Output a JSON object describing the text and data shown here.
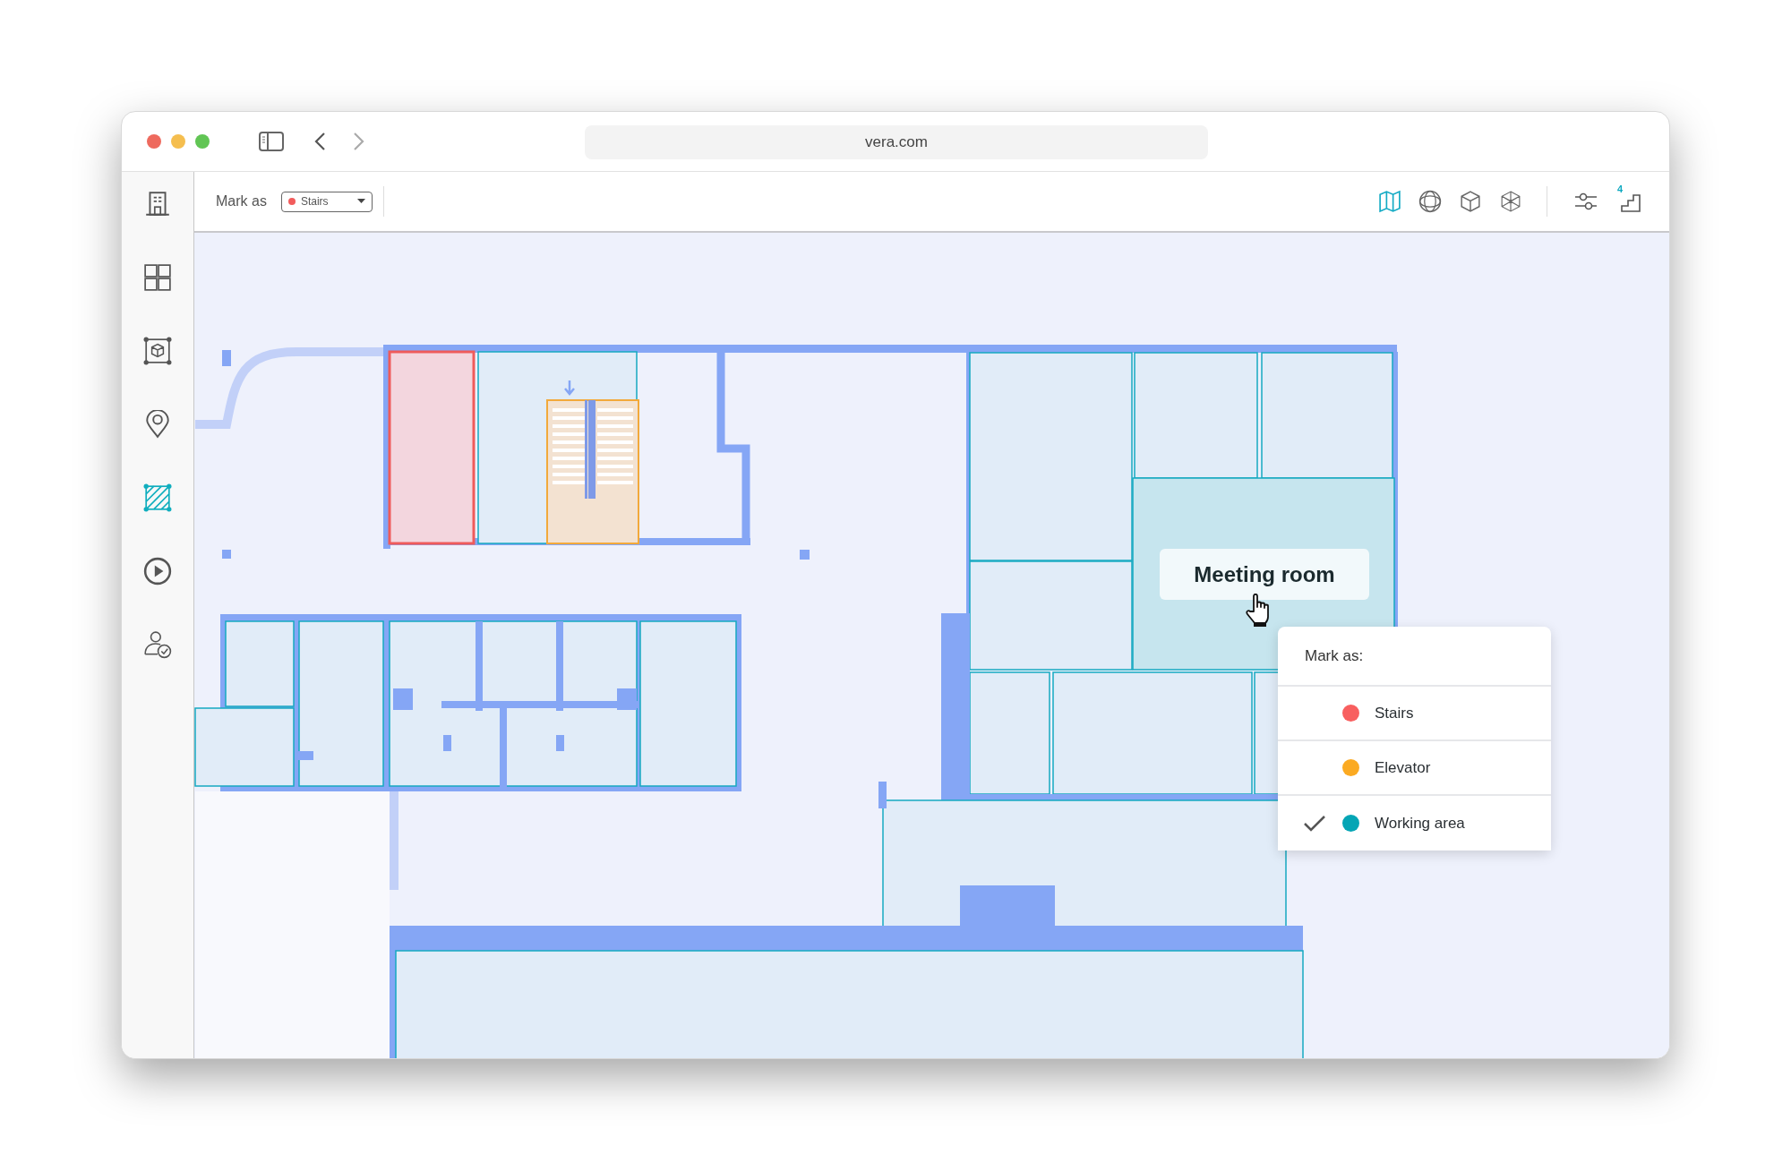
{
  "browser": {
    "url": "vera.com"
  },
  "sidebar": {
    "items": [
      {
        "kind": "building",
        "selected": false
      },
      {
        "kind": "grid",
        "selected": false
      },
      {
        "kind": "model",
        "selected": false
      },
      {
        "kind": "pin",
        "selected": false
      },
      {
        "kind": "area",
        "selected": true
      },
      {
        "kind": "play",
        "selected": false
      },
      {
        "kind": "user",
        "selected": false
      }
    ]
  },
  "toolbar": {
    "label": "Mark as",
    "dropdown": {
      "value": "Stairs",
      "color": "#f25c5c"
    },
    "view_modes": [
      {
        "kind": "map",
        "selected": true
      },
      {
        "kind": "globe",
        "selected": false
      },
      {
        "kind": "cube",
        "selected": false
      },
      {
        "kind": "wireframe",
        "selected": false
      }
    ],
    "floor_badge": "4"
  },
  "map": {
    "tooltip": "Meeting room"
  },
  "menu": {
    "title": "Mark as:",
    "options": [
      {
        "label": "Stairs",
        "color": "#f85f5f",
        "selected": false
      },
      {
        "label": "Elevator",
        "color": "#fbaa22",
        "selected": false
      },
      {
        "label": "Working area",
        "color": "#04a5b5",
        "selected": true
      }
    ]
  }
}
